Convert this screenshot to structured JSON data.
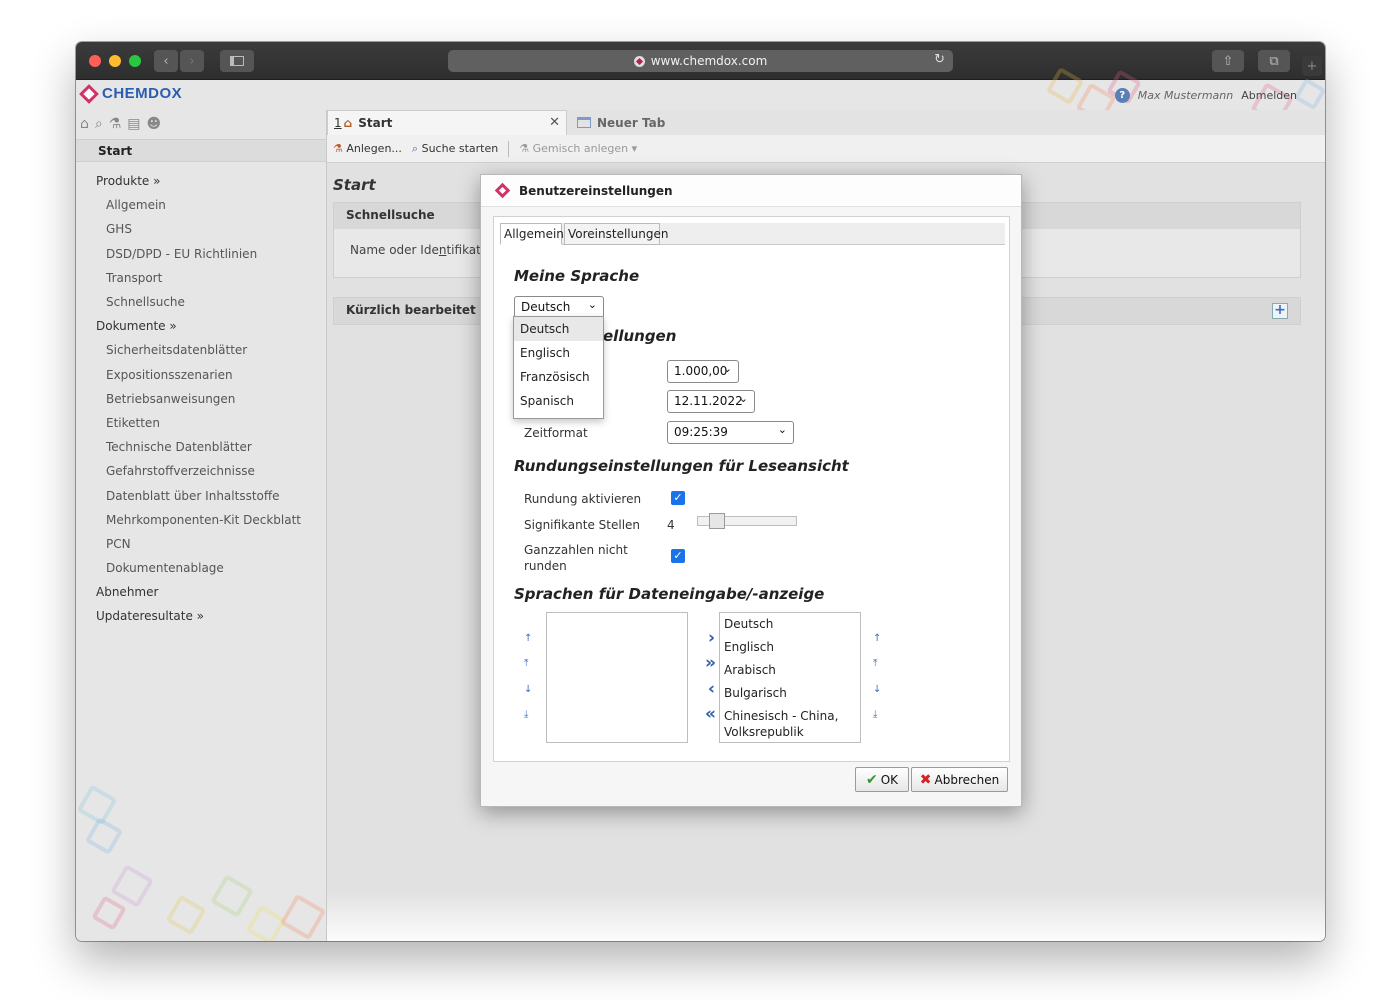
{
  "browser": {
    "url": "www.chemdox.com",
    "buttons": {
      "back": "‹",
      "forward": "›",
      "reload": "↻",
      "share": "⇧",
      "tabs": "⧉",
      "new_tab": "+"
    }
  },
  "app": {
    "logo_text": "CHEMDOX",
    "user_name": "Max Mustermann",
    "logout": "Abmelden",
    "help_glyph": "?"
  },
  "sidebar": {
    "start": "Start",
    "items": [
      {
        "label": "Produkte »",
        "level": 0
      },
      {
        "label": "Allgemein",
        "level": 1
      },
      {
        "label": "GHS",
        "level": 1
      },
      {
        "label": "DSD/DPD - EU Richtlinien",
        "level": 1
      },
      {
        "label": "Transport",
        "level": 1
      },
      {
        "label": "Schnellsuche",
        "level": 1
      },
      {
        "label": "Dokumente »",
        "level": 0
      },
      {
        "label": "Sicherheitsdatenblätter",
        "level": 1
      },
      {
        "label": "Expositionsszenarien",
        "level": 1
      },
      {
        "label": "Betriebsanweisungen",
        "level": 1
      },
      {
        "label": "Etiketten",
        "level": 1
      },
      {
        "label": "Technische Datenblätter",
        "level": 1
      },
      {
        "label": "Gefahrstoffverzeichnisse",
        "level": 1
      },
      {
        "label": "Datenblatt über Inhaltsstoffe",
        "level": 1
      },
      {
        "label": "Mehrkomponenten-Kit Deckblatt",
        "level": 1
      },
      {
        "label": "PCN",
        "level": 1
      },
      {
        "label": "Dokumentenablage",
        "level": 1
      },
      {
        "label": "Abnehmer",
        "level": 0
      },
      {
        "label": "Updateresultate »",
        "level": 0
      }
    ]
  },
  "tabs": {
    "active": {
      "number": "1",
      "label": "Start",
      "close": "✕"
    },
    "inactive": {
      "label": "Neuer Tab"
    }
  },
  "toolbar": {
    "create": "Anlegen...",
    "search": "Suche starten",
    "mixture": "Gemisch anlegen"
  },
  "content": {
    "title": "Start",
    "quicksearch_title": "Schnellsuche",
    "quicksearch_label_pre": "Name oder Ide",
    "quicksearch_label_u": "n",
    "quicksearch_label_post": "tifikator",
    "recent_title": "Kürzlich bearbeitet"
  },
  "dialog": {
    "title": "Benutzereinstellungen",
    "tabs": [
      "Allgemein",
      "Voreinstellungen"
    ],
    "lang_section": "Meine Sprache",
    "language_value": "Deutsch",
    "language_options": [
      "Deutsch",
      "Englisch",
      "Französisch",
      "Spanisch"
    ],
    "format_section_visible": "ellungen",
    "number_format": "1.000,00",
    "date_format": "12.11.2022",
    "time_label": "Zeitformat",
    "time_format": "09:25:39",
    "rounding_section": "Rundungseinstellungen für Leseansicht",
    "rounding_enable": "Rundung aktivieren",
    "rounding_enable_checked": true,
    "significant_label": "Signifikante Stellen",
    "significant_value": "4",
    "integers_label_1": "Ganzzahlen nicht",
    "integers_label_2": "runden",
    "integers_checked": true,
    "languages_section": "Sprachen für Dateneingabe/-anzeige",
    "available_languages": [],
    "selected_languages": [
      "Deutsch",
      "Englisch",
      "Arabisch",
      "Bulgarisch",
      "Chinesisch - China,",
      "Volksrepublik"
    ],
    "ok": "OK",
    "cancel": "Abbrechen"
  },
  "colors": {
    "brand_pink": "#d0336a",
    "brand_blue": "#2a5db0",
    "checkbox_blue": "#1a73e8"
  }
}
